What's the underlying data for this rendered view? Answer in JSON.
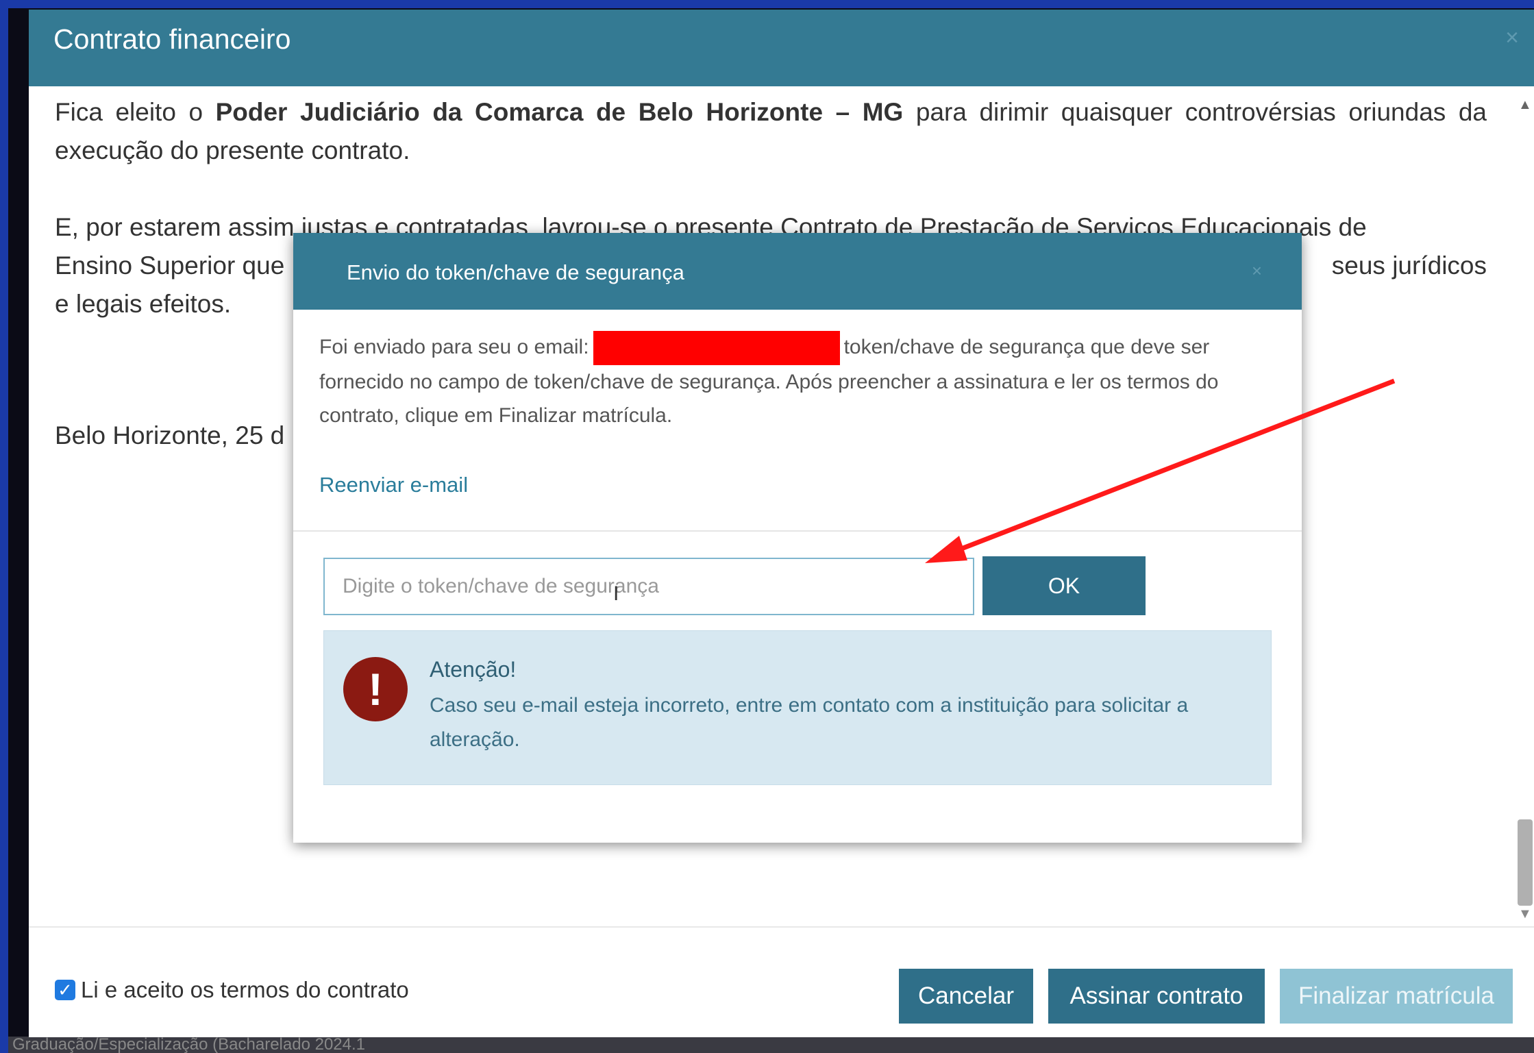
{
  "window": {
    "bottom_strip_text": "Graduação/Especialização (Bacharelado 2024.1"
  },
  "modal": {
    "title": "Contrato financeiro",
    "close_icon": "×",
    "body": {
      "para1_start": "Fica eleito o ",
      "para1_bold": "Poder Judiciário da Comarca de Belo Horizonte – MG",
      "para1_end": " para dirimir quaisquer controvérsias oriundas da execução do presente contrato.",
      "para2_start": "E, por estarem assim justas e contratadas, lavrou-se o presente Contrato de Prestação de Serviços Educacionais de",
      "para2_line2_start": "Ensino Superior que",
      "para2_line2_end": "seus jurídicos",
      "para2_line3": "e legais efeitos.",
      "para3": "Belo Horizonte, 25 d"
    },
    "footer": {
      "accept_label": "Li e aceito os termos do contrato",
      "checkbox_checked": true,
      "cancel_label": "Cancelar",
      "sign_label": "Assinar contrato",
      "finalize_label": "Finalizar matrícula"
    }
  },
  "dialog": {
    "title": "Envio do token/chave de segurança",
    "close_icon": "×",
    "text_start": "Foi enviado para seu o email:",
    "text_end": "token/chave de segurança que deve ser fornecido no campo de token/chave de segurança. Após preencher a assinatura e ler os termos do contrato, clique em Finalizar matrícula.",
    "resend_label": "Reenviar e-mail",
    "token_input": {
      "value": "",
      "placeholder": "Digite o token/chave de segurança"
    },
    "ok_label": "OK",
    "alert": {
      "icon": "!",
      "title": "Atenção!",
      "text": "Caso seu e-mail esteja incorreto, entre em contato com a instituição para solicitar a alteração."
    }
  },
  "colors": {
    "header": "#347a93",
    "button": "#2f6f89",
    "button_disabled": "#8fc3d4",
    "alert_bg": "#d7e8f1",
    "arrow": "#ff1a1a",
    "redaction": "#ff0000"
  }
}
